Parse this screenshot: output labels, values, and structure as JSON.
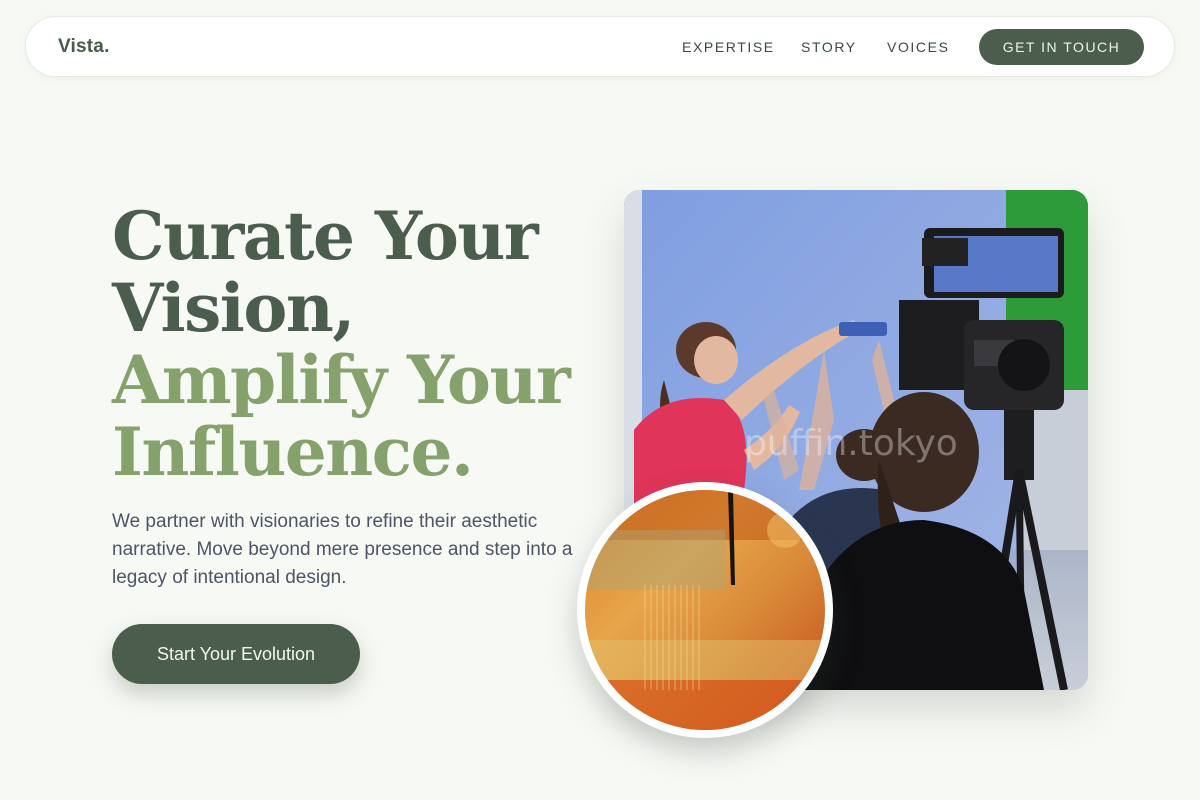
{
  "brand": {
    "logo": "Vista."
  },
  "nav": {
    "links": [
      "EXPERTISE",
      "STORY",
      "VOICES"
    ],
    "cta": "GET IN TOUCH"
  },
  "hero": {
    "title_line1": "Curate Your",
    "title_line2": "Vision,",
    "title_line3": "Amplify Your",
    "title_line4": "Influence.",
    "subtitle": "We partner with visionaries to refine their aesthetic narrative. Move beyond mere presence and step into a legacy of intentional design.",
    "cta": "Start Your Evolution"
  },
  "images": {
    "main": "film-crew-camera-photo",
    "watermark": "puffin.tokyo",
    "circle": "textured-orange-painting"
  },
  "colors": {
    "background": "#f7f9f5",
    "primary_dark": "#4b5d4c",
    "accent_green": "#86a26c",
    "body_text": "#4d5566"
  }
}
